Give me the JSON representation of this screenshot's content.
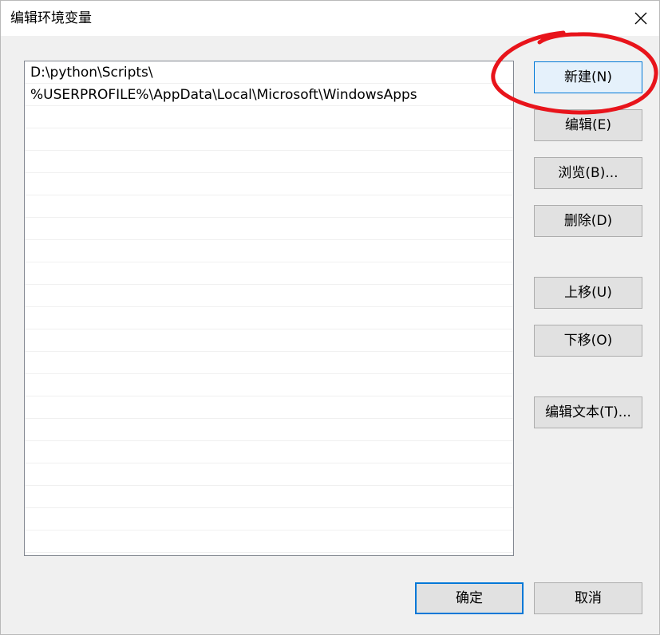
{
  "window": {
    "title": "编辑环境变量",
    "close_icon": "close-icon"
  },
  "path_list": {
    "items": [
      "D:\\python\\Scripts\\",
      "%USERPROFILE%\\AppData\\Local\\Microsoft\\WindowsApps",
      "",
      "",
      "",
      "",
      "",
      "",
      "",
      "",
      "",
      "",
      "",
      "",
      "",
      "",
      "",
      "",
      "",
      "",
      "",
      ""
    ]
  },
  "buttons": {
    "new": "新建(N)",
    "edit": "编辑(E)",
    "browse": "浏览(B)...",
    "delete": "删除(D)",
    "move_up": "上移(U)",
    "move_down": "下移(O)",
    "edit_text": "编辑文本(T)..."
  },
  "footer": {
    "ok": "确定",
    "cancel": "取消"
  },
  "colors": {
    "accent": "#0078d7",
    "annotation": "#e8141b"
  }
}
